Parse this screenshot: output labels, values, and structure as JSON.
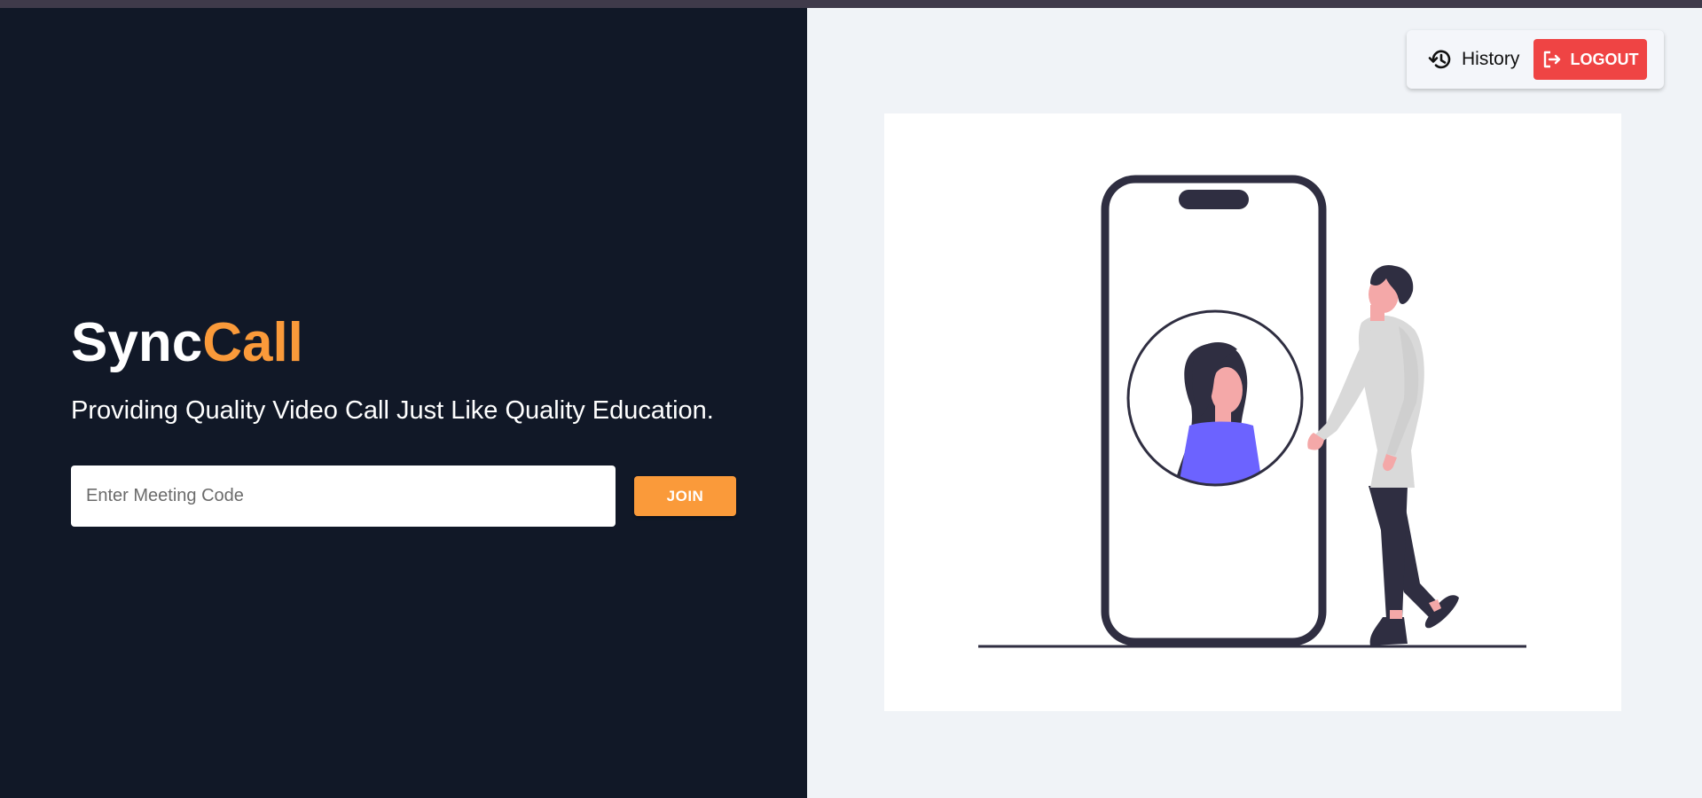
{
  "app": {
    "brand_primary": "Sync",
    "brand_accent": "Call",
    "tagline": "Providing Quality Video Call Just Like Quality Education."
  },
  "meeting": {
    "input_placeholder": "Enter Meeting Code",
    "input_value": "",
    "join_label": "JOIN"
  },
  "nav": {
    "history_label": "History",
    "history_icon": "history-icon",
    "logout_label": "LOGOUT",
    "logout_icon": "logout-icon"
  },
  "illustration": {
    "name": "video-call-illustration"
  },
  "colors": {
    "left_bg": "#111827",
    "right_bg": "#f0f3f7",
    "accent": "#fa9a3a",
    "logout": "#ef4444",
    "illustration_dark": "#2f2e41",
    "illustration_purple": "#6c63ff"
  }
}
